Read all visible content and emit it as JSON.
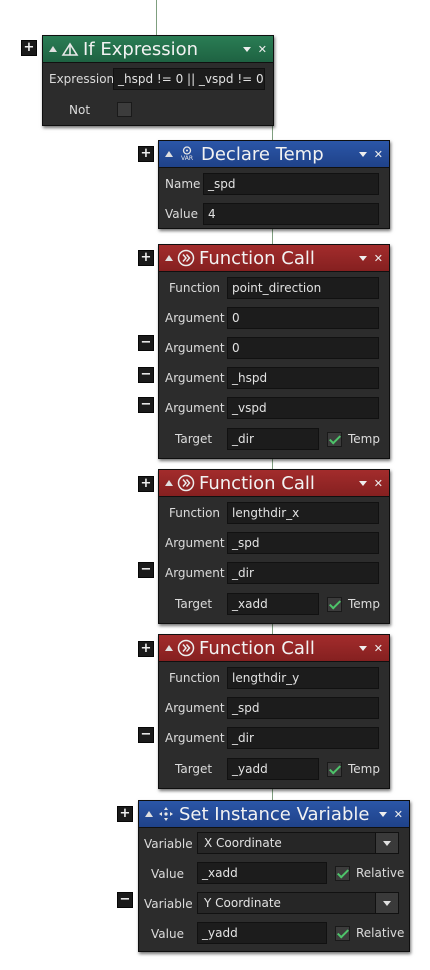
{
  "if_block": {
    "title": "If Expression",
    "expression_label": "Expression",
    "expression_value": "_hspd != 0 || _vspd != 0",
    "not_label": "Not",
    "not_checked": false
  },
  "declare_block": {
    "title": "Declare Temp",
    "icon_text": "VAR",
    "name_label": "Name",
    "name_value": "_spd",
    "value_label": "Value",
    "value_value": "4"
  },
  "func1": {
    "title": "Function Call",
    "function_label": "Function",
    "function_value": "point_direction",
    "arguments": [
      {
        "label": "Argument",
        "value": "0"
      },
      {
        "label": "Argument",
        "value": "0"
      },
      {
        "label": "Argument",
        "value": "_hspd"
      },
      {
        "label": "Argument",
        "value": "_vspd"
      }
    ],
    "target_label": "Target",
    "target_value": "_dir",
    "temp_label": "Temp",
    "temp_checked": true
  },
  "func2": {
    "title": "Function Call",
    "function_label": "Function",
    "function_value": "lengthdir_x",
    "arguments": [
      {
        "label": "Argument",
        "value": "_spd"
      },
      {
        "label": "Argument",
        "value": "_dir"
      }
    ],
    "target_label": "Target",
    "target_value": "_xadd",
    "temp_label": "Temp",
    "temp_checked": true
  },
  "func3": {
    "title": "Function Call",
    "function_label": "Function",
    "function_value": "lengthdir_y",
    "arguments": [
      {
        "label": "Argument",
        "value": "_spd"
      },
      {
        "label": "Argument",
        "value": "_dir"
      }
    ],
    "target_label": "Target",
    "target_value": "_yadd",
    "temp_label": "Temp",
    "temp_checked": true
  },
  "set_block": {
    "title": "Set Instance Variable",
    "rows": [
      {
        "var_label": "Variable",
        "var_value": "X Coordinate",
        "val_label": "Value",
        "val_value": "_xadd",
        "relative_label": "Relative",
        "relative_checked": true
      },
      {
        "var_label": "Variable",
        "var_value": "Y Coordinate",
        "val_label": "Value",
        "val_value": "_yadd",
        "relative_label": "Relative",
        "relative_checked": true
      }
    ]
  },
  "side_buttons": {
    "plus": "+",
    "minus": "−"
  },
  "colors": {
    "green_header": "#22704b",
    "blue_header": "#2548a0",
    "red_header": "#942626",
    "panel": "#2c2c2c",
    "check": "#4ec46a"
  }
}
